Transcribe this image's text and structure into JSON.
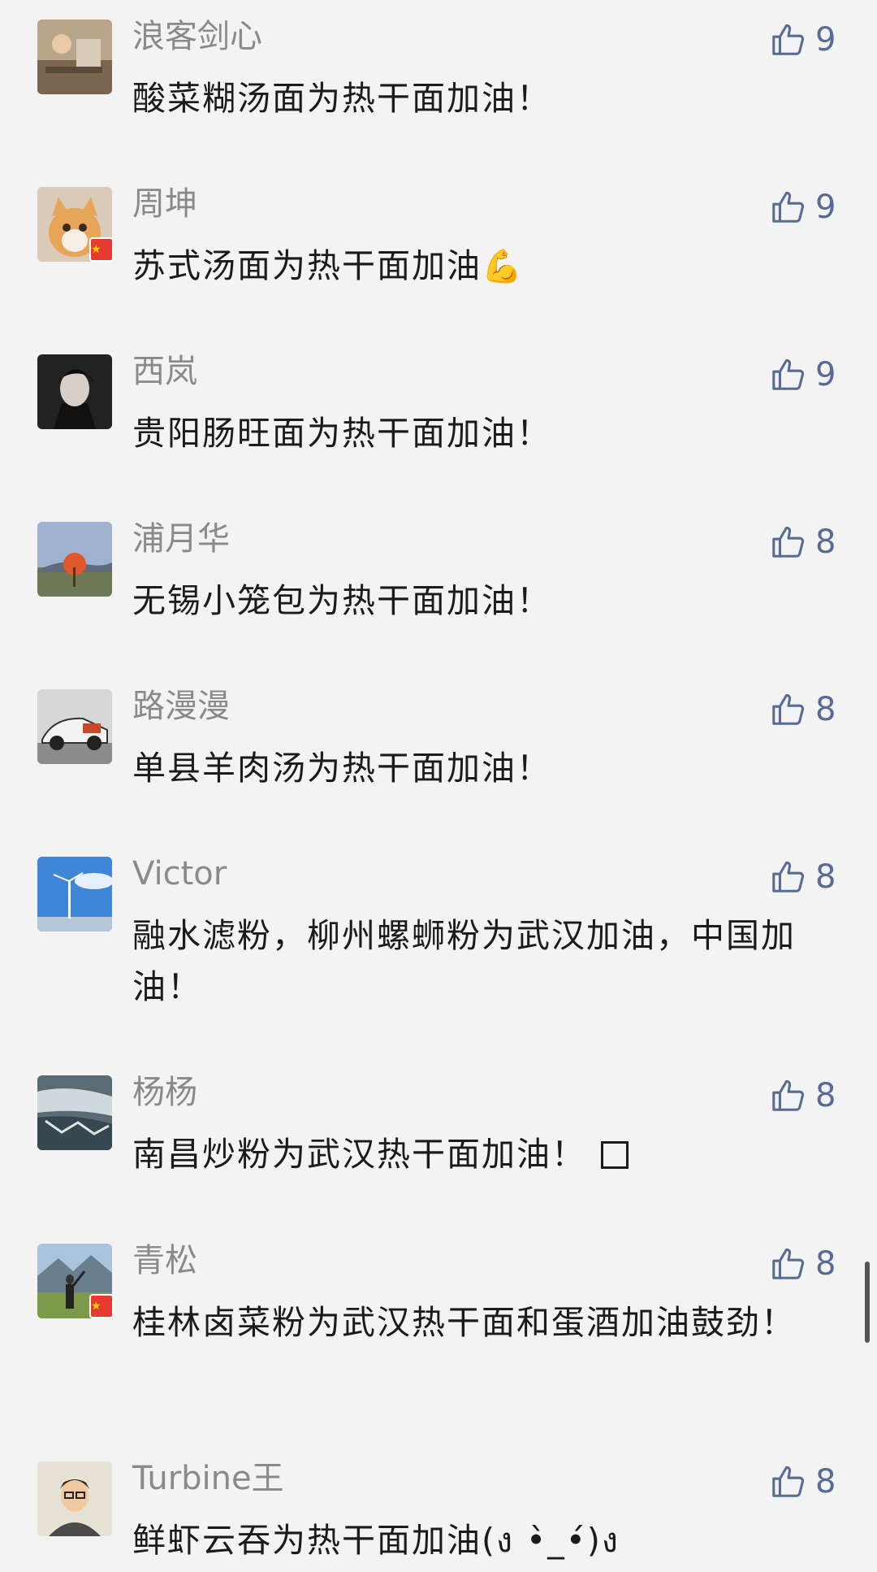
{
  "comments": [
    {
      "name": "浪客剑心",
      "text": "酸菜糊汤面为热干面加油！",
      "likes": "9"
    },
    {
      "name": "周坤",
      "text": "苏式汤面为热干面加油",
      "emoji": "💪",
      "likes": "9",
      "flag": true
    },
    {
      "name": "西岚",
      "text": "贵阳肠旺面为热干面加油！",
      "likes": "9"
    },
    {
      "name": "浦月华",
      "text": "无锡小笼包为热干面加油！",
      "likes": "8"
    },
    {
      "name": "路漫漫",
      "text": "单县羊肉汤为热干面加油！",
      "likes": "8"
    },
    {
      "name": "Victor",
      "text": "融水滤粉，柳州螺蛳粉为武汉加油，中国加油！",
      "likes": "8"
    },
    {
      "name": "杨杨",
      "text": "南昌炒粉为武汉热干面加油！",
      "likes": "8"
    },
    {
      "name": "青松",
      "text": "桂林卤菜粉为武汉热干面和蛋酒加油鼓劲！",
      "likes": "8",
      "flag": true
    },
    {
      "name": "Turbine王",
      "text": "鲜虾云吞为热干面加油(ง •̀_•́)ง",
      "likes": "8"
    }
  ],
  "icons": {
    "like": "thumbs-up-icon",
    "flag": "china-flag-icon"
  },
  "colors": {
    "likeBlue": "#576b95",
    "name": "#8a8a8a",
    "text": "#1b1b1b",
    "background": "#f3f3f3"
  }
}
